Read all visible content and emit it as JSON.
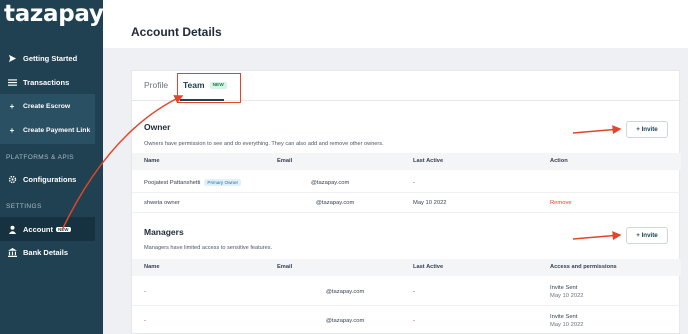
{
  "brand": {
    "logo": "tazapay"
  },
  "sidebar": {
    "items": [
      {
        "label": "Getting Started",
        "icon": "send-icon"
      },
      {
        "label": "Transactions",
        "icon": "list-icon"
      },
      {
        "label": "Create Escrow",
        "icon": "plus-icon"
      },
      {
        "label": "Create Payment Link",
        "icon": "plus-icon"
      },
      {
        "label": "Configurations",
        "icon": "gear-icon"
      },
      {
        "label": "Account",
        "icon": "user-icon",
        "tag": "NEW"
      },
      {
        "label": "Bank Details",
        "icon": "bank-icon"
      }
    ],
    "sections": {
      "platforms": "PLATFORMS & APIS",
      "settings": "SETTINGS"
    }
  },
  "header": {
    "title": "Account Details"
  },
  "tabs": [
    {
      "label": "Profile"
    },
    {
      "label": "Team",
      "tag": "NEW"
    }
  ],
  "owner": {
    "title": "Owner",
    "description": "Owners have permission to see and do everything. They can also add and remove other owners.",
    "invite_label": "+ Invite",
    "columns": [
      "Name",
      "Email",
      "Last Active",
      "Action"
    ],
    "rows": [
      {
        "name": "Poojatest Pattanshetti",
        "badge": "Primary Owner",
        "email": "@tazapay.com",
        "last_active": "-",
        "action": ""
      },
      {
        "name": "shweta owner",
        "badge": "",
        "email": "@tazapay.com",
        "last_active": "May 10 2022",
        "action": "Remove"
      }
    ]
  },
  "managers": {
    "title": "Managers",
    "description": "Managers have limited access to sensitive features.",
    "invite_label": "+ Invite",
    "columns": [
      "Name",
      "Email",
      "Last Active",
      "Access and permissions"
    ],
    "rows": [
      {
        "name": "-",
        "email": "@tazapay.com",
        "last_active": "-",
        "status": "Invite Sent",
        "date": "May 10 2022"
      },
      {
        "name": "-",
        "email": "@tazapay.com",
        "last_active": "-",
        "status": "Invite Sent",
        "date": "May 10 2022"
      }
    ]
  },
  "colors": {
    "sidebar": "#1f4152",
    "accent": "#e2452a",
    "remove": "#e2452a"
  }
}
